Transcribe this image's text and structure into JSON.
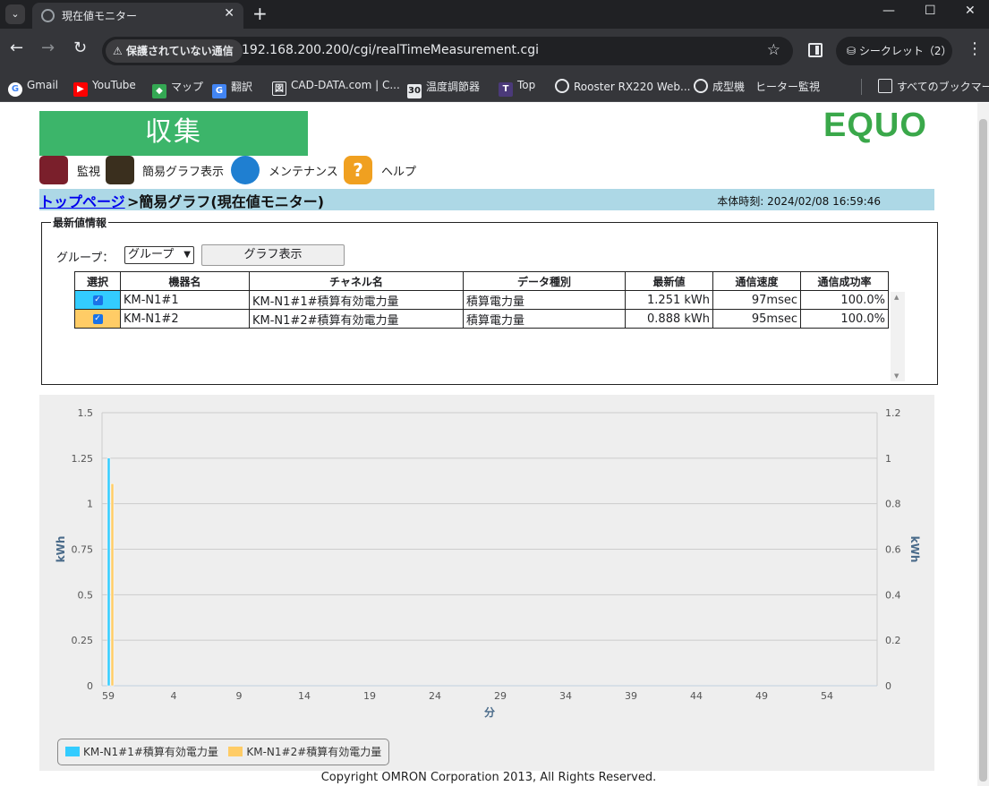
{
  "browser": {
    "tab_title": "現在値モニター",
    "security_label": "保護されていない通信",
    "url": "192.168.200.200/cgi/realTimeMeasurement.cgi",
    "incognito_label": "シークレット（2）",
    "bookmarks": [
      "Gmail",
      "YouTube",
      "マップ",
      "翻訳",
      "CAD-DATA.com | C...",
      "温度調節器",
      "Top",
      "Rooster RX220 Web...",
      "成型機　ヒーター監視"
    ],
    "all_bookmarks": "すべてのブックマーク"
  },
  "page": {
    "banner": "収集",
    "brand": "EQUO",
    "menu": [
      {
        "label": "監視",
        "color": "#7a1f2b"
      },
      {
        "label": "簡易グラフ表示",
        "color": "#3a2f1e"
      },
      {
        "label": "メンテナンス",
        "color": "#1f7fd1"
      },
      {
        "label": "ヘルプ",
        "color": "#f0a020"
      }
    ],
    "breadcrumb_link": "トップページ",
    "breadcrumb_rest": ">簡易グラフ(現在値モニター)",
    "clock": "本体時刻:  2024/02/08 16:59:46"
  },
  "info": {
    "legend": "最新値情報",
    "group_label": "グループ：",
    "group_value": "グループ",
    "graph_button": "グラフ表示",
    "columns": [
      "選択",
      "機器名",
      "チャネル名",
      "データ種別",
      "最新値",
      "通信速度",
      "通信成功率"
    ],
    "rows": [
      {
        "color": "#33ccff",
        "device": "KM-N1#1",
        "channel": "KM-N1#1#積算有効電力量",
        "type": "積算電力量",
        "latest": "1.251 kWh",
        "speed": "97msec",
        "rate": "100.0%"
      },
      {
        "color": "#ffcc66",
        "device": "KM-N1#2",
        "channel": "KM-N1#2#積算有効電力量",
        "type": "積算電力量",
        "latest": "0.888 kWh",
        "speed": "95msec",
        "rate": "100.0%"
      }
    ]
  },
  "chart_data": {
    "type": "bar",
    "xlabel": "分",
    "ylabel": "kWh",
    "y2label": "kWh",
    "ylim": [
      0,
      1.5
    ],
    "y2lim": [
      0,
      1.2
    ],
    "yticks": [
      0,
      0.25,
      0.5,
      0.75,
      1,
      1.25,
      1.5
    ],
    "y2ticks": [
      0,
      0.2,
      0.4,
      0.6,
      0.8,
      1,
      1.2
    ],
    "xticks": [
      "59",
      "4",
      "9",
      "14",
      "19",
      "24",
      "29",
      "34",
      "39",
      "44",
      "49",
      "54"
    ],
    "grid": true,
    "legend_position": "bottom-left",
    "series": [
      {
        "name": "KM-N1#1#積算有効電力量",
        "color": "#33ccff",
        "axis": "left",
        "x": "59",
        "value": 1.251
      },
      {
        "name": "KM-N1#2#積算有効電力量",
        "color": "#ffcc66",
        "axis": "right",
        "x": "59",
        "value": 0.888
      }
    ]
  },
  "footer": {
    "copyright": "Copyright OMRON Corporation 2013, All Rights Reserved."
  }
}
